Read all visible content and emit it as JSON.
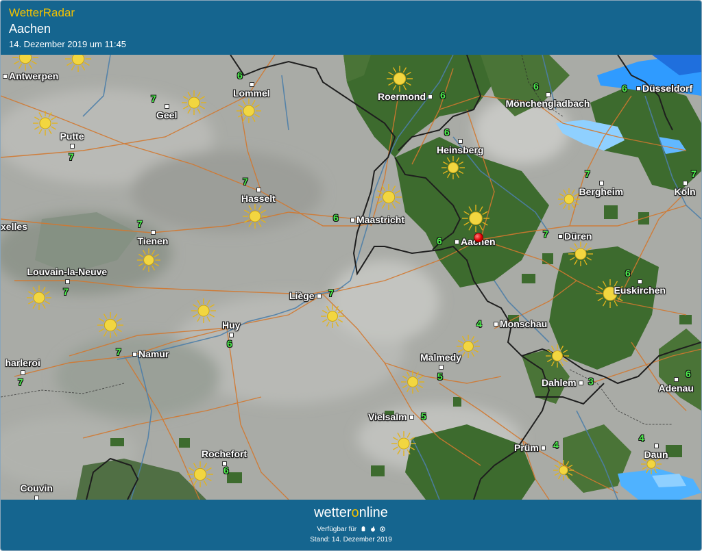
{
  "header": {
    "app_title": "WetterRadar",
    "location": "Aachen",
    "datetime": "14. Dezember 2019 um 11:45"
  },
  "colors": {
    "header_bg": "#15658f",
    "accent_yellow": "#f2c200",
    "clear_sky_green": "#3d6b2e",
    "cloud_grey": "#a7a9a4",
    "temperature_green": "#4cf04c",
    "precip_blue": "#2f9bff",
    "border_black": "#222222",
    "road_orange": "#d2782f",
    "river_blue": "#4d7ea8",
    "pin_red": "#e00000"
  },
  "cities": [
    {
      "id": "antwerpen",
      "name": "Antwerpen"
    },
    {
      "id": "lommel",
      "name": "Lommel"
    },
    {
      "id": "geel",
      "name": "Geel"
    },
    {
      "id": "putte",
      "name": "Putte"
    },
    {
      "id": "hasselt",
      "name": "Hasselt"
    },
    {
      "id": "roermond",
      "name": "Roermond"
    },
    {
      "id": "moenchengladbach",
      "name": "Mönchengladbach"
    },
    {
      "id": "duesseldorf",
      "name": "Düsseldorf"
    },
    {
      "id": "heinsberg",
      "name": "Heinsberg"
    },
    {
      "id": "bergheim",
      "name": "Bergheim"
    },
    {
      "id": "koeln",
      "name": "Köln"
    },
    {
      "id": "maastricht",
      "name": "Maastricht"
    },
    {
      "id": "aachen",
      "name": "Aachen"
    },
    {
      "id": "dueren",
      "name": "Düren"
    },
    {
      "id": "bruxelles",
      "name": "xelles"
    },
    {
      "id": "tienen",
      "name": "Tienen"
    },
    {
      "id": "louvain",
      "name": "Louvain-la-Neuve"
    },
    {
      "id": "liege",
      "name": "Liège"
    },
    {
      "id": "euskirchen",
      "name": "Euskirchen"
    },
    {
      "id": "huy",
      "name": "Huy"
    },
    {
      "id": "monschau",
      "name": "Monschau"
    },
    {
      "id": "charleroi",
      "name": "harleroi"
    },
    {
      "id": "namur",
      "name": "Namur"
    },
    {
      "id": "malmedy",
      "name": "Malmedy"
    },
    {
      "id": "dahlem",
      "name": "Dahlem"
    },
    {
      "id": "adenau",
      "name": "Adenau"
    },
    {
      "id": "vielsalm",
      "name": "Vielsalm"
    },
    {
      "id": "pruem",
      "name": "Prüm"
    },
    {
      "id": "rochefort",
      "name": "Rochefort"
    },
    {
      "id": "daun",
      "name": "Daun"
    },
    {
      "id": "couvin",
      "name": "Couvin"
    }
  ],
  "temperatures": [
    {
      "id": "lommel",
      "value": "6"
    },
    {
      "id": "geel",
      "value": "7"
    },
    {
      "id": "putte",
      "value": "7"
    },
    {
      "id": "hasselt",
      "value": "7"
    },
    {
      "id": "roermond",
      "value": "6"
    },
    {
      "id": "moenchengladbach",
      "value": "6"
    },
    {
      "id": "duesseldorf",
      "value": "6"
    },
    {
      "id": "heinsberg",
      "value": "6"
    },
    {
      "id": "bergheim",
      "value": "7"
    },
    {
      "id": "koeln",
      "value": "7"
    },
    {
      "id": "maastricht",
      "value": "6"
    },
    {
      "id": "aachen",
      "value": "6"
    },
    {
      "id": "dueren",
      "value": "7"
    },
    {
      "id": "tienen",
      "value": "7"
    },
    {
      "id": "louvain",
      "value": "7"
    },
    {
      "id": "liege",
      "value": "7"
    },
    {
      "id": "euskirchen",
      "value": "6"
    },
    {
      "id": "huy",
      "value": "6"
    },
    {
      "id": "monschau",
      "value": "4"
    },
    {
      "id": "charleroi",
      "value": "7"
    },
    {
      "id": "namur",
      "value": "7"
    },
    {
      "id": "malmedy",
      "value": "5"
    },
    {
      "id": "dahlem",
      "value": "3"
    },
    {
      "id": "adenau",
      "value": "6"
    },
    {
      "id": "vielsalm",
      "value": "5"
    },
    {
      "id": "pruem",
      "value": "4"
    },
    {
      "id": "rochefort",
      "value": "6"
    },
    {
      "id": "daun",
      "value": "4"
    }
  ],
  "weather_icons": "sun-icon",
  "footer": {
    "brand_a": "wetter",
    "brand_o": "o",
    "brand_b": "nline",
    "available": "Verfügbar für",
    "platform_icons": [
      "android-icon",
      "apple-icon",
      "web-icon"
    ],
    "stand": "Stand: 14. Dezember 2019"
  }
}
